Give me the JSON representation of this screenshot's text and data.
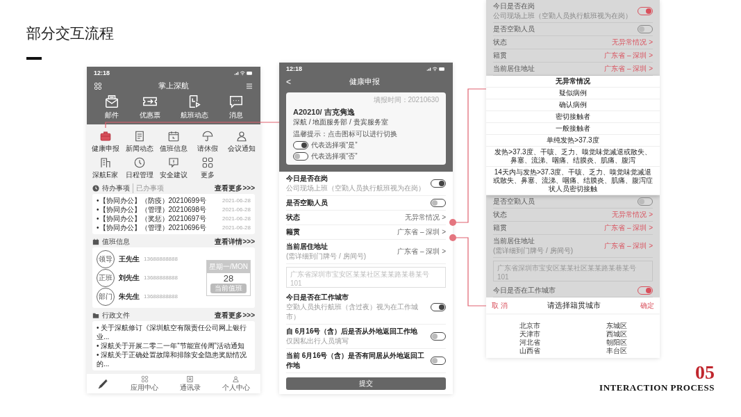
{
  "title": "部分交互流程",
  "home": {
    "time": "12:18",
    "title": "掌上深航",
    "shortcuts": [
      {
        "label": "邮件"
      },
      {
        "label": "优惠票"
      },
      {
        "label": "航班动态"
      },
      {
        "label": "消息"
      }
    ],
    "apps": [
      {
        "label": "健康申报",
        "selected": true
      },
      {
        "label": "新闻动态",
        "selected": false
      },
      {
        "label": "值班信息",
        "selected": false
      },
      {
        "label": "请休假",
        "selected": false
      },
      {
        "label": "会议通知",
        "selected": false
      },
      {
        "label": "深航E家",
        "selected": false
      },
      {
        "label": "日程管理",
        "selected": false
      },
      {
        "label": "安全建议",
        "selected": false
      },
      {
        "label": "更多",
        "selected": false
      }
    ],
    "todo": {
      "title": "待办事项",
      "tab": "已办事项",
      "more": "查看更多>>>",
      "items": [
        {
          "text": "•【协同办公】（防疫）20210699号",
          "date": "2021-06-28"
        },
        {
          "text": "•【协同办公】（管理）20210698号",
          "date": "2021-06-28"
        },
        {
          "text": "•【协同办公】（奖惩）20210697号",
          "date": "2021-06-28"
        },
        {
          "text": "•【协同办公】（管理）20210696号",
          "date": "2021-06-28"
        }
      ]
    },
    "duty": {
      "title": "值班信息",
      "more": "查看详情>>>",
      "people": [
        {
          "role": "领导",
          "name": "王先生",
          "phone": "13688888888"
        },
        {
          "role": "正班",
          "name": "刘先生",
          "phone": "13688888888"
        },
        {
          "role": "部门",
          "name": "朱先生",
          "phone": "13688888888"
        }
      ],
      "weekday": "星期一/MON",
      "day": "28",
      "badge": "当前值班"
    },
    "docs": {
      "title": "行政文件",
      "more": "查看更多>>>",
      "items": [
        {
          "text": "• 关于深航修订《深圳航空有限责任公司网上银行业..."
        },
        {
          "text": "• 深航关于开展二零二一年“节能宣传周”活动通知"
        },
        {
          "text": "• 深航关于正确处置故障和排除安全隐患奖励情况的..."
        }
      ]
    },
    "tabbar": [
      {
        "selected": true
      },
      {
        "label": "应用中心",
        "selected": false
      },
      {
        "label": "通讯录",
        "selected": false
      },
      {
        "label": "个人中心",
        "selected": false
      }
    ]
  },
  "form": {
    "time": "12:18",
    "back": "<",
    "title": "健康申报",
    "card": {
      "filled": "填报时间：20210630",
      "name": "A20210/ 吉克隽逸",
      "dept": "深航 / 地面服务部 / 贵宾服务室",
      "tip": "温馨提示：点击图标可以进行切换",
      "legend": [
        {
          "on": true,
          "text": "代表选择项“是”"
        },
        {
          "on": false,
          "text": "代表选择项“否”"
        }
      ]
    },
    "rows": [
      {
        "kind": "toggle",
        "label": "今日是否在岗",
        "sub": "公司现场上班（空勤人员执行航班视为在岗）",
        "on": true
      },
      {
        "kind": "toggle",
        "label": "是否空勤人员",
        "on": false
      },
      {
        "kind": "select",
        "label": "状态",
        "value": "无异常情况 >"
      },
      {
        "kind": "select",
        "label": "籍贯",
        "value": "广东省 – 深圳 >"
      },
      {
        "kind": "select",
        "label": "当前居住地址",
        "sub": "(需详细到门牌号 / 房间号)",
        "value": "广东省 – 深圳 >"
      },
      {
        "kind": "textarea",
        "placeholder": "广东省深圳市宝安区某某社区某某路某巷某号 101"
      },
      {
        "kind": "toggle",
        "label": "今日是否在工作城市",
        "sub": "空勤人员执行航班（含过夜）视为在工作城市）",
        "on": true
      },
      {
        "kind": "toggle",
        "label": "自 6月16号（含）后是否从外地返回工作地",
        "sub": "仅因私出行人员填写",
        "on": false
      },
      {
        "kind": "toggle",
        "label": "当前 6月16号（含）是否有同居从外地返回工作地",
        "on": false
      }
    ],
    "submit": "提交"
  },
  "status_picker": {
    "rows": [
      {
        "kind": "toggle",
        "label": "今日是否在岗",
        "sub": "公司现场上班（空勤人员执行航班视为在岗）",
        "on": true
      },
      {
        "kind": "toggle",
        "label": "是否空勤人员",
        "on": false
      },
      {
        "kind": "select",
        "label": "状态",
        "value": "无异常情况 >"
      },
      {
        "kind": "select",
        "label": "籍贯",
        "value": "广东省 – 深圳 >"
      },
      {
        "kind": "select",
        "label": "当前居住地址",
        "value": "广东省 – 深圳 >"
      }
    ],
    "options": [
      {
        "label": "无异常情况",
        "selected": true
      },
      {
        "label": "疑似病例",
        "selected": false
      },
      {
        "label": "确认病例",
        "selected": false
      },
      {
        "label": "密切接触者",
        "selected": false
      },
      {
        "label": "一般接触者",
        "selected": false
      },
      {
        "label": "单纯发热>37.3度",
        "selected": false
      },
      {
        "label": "发热>37.3度、干咳、乏力、嗅觉味觉减退或散失、鼻塞、流涕、咽痛、结膜炎、肌痛、腹泻",
        "selected": false
      },
      {
        "label": "14天内与发热>37.3度、干咳、乏力、嗅觉味觉减退或散失、鼻塞、流涕、咽痛、结膜炎、肌痛、腹泻症状人员密切接触",
        "selected": false
      }
    ]
  },
  "city_picker": {
    "rows": [
      {
        "kind": "toggle",
        "label": "是否空勤人员",
        "on": false
      },
      {
        "kind": "select",
        "label": "状态",
        "value": "无异常情况 >"
      },
      {
        "kind": "select",
        "label": "籍贯",
        "value": "广东省 – 深圳 >"
      },
      {
        "kind": "select",
        "label": "当前居住地址",
        "sub": "(需详细到门牌号 / 房间号)",
        "value": "广东省 – 深圳 >"
      },
      {
        "kind": "textarea",
        "placeholder": "广东省深圳市宝安区某某社区某某路某巷某号 101"
      },
      {
        "kind": "toggle",
        "label": "今日是否在工作城市",
        "on": true
      }
    ],
    "cancel": "取 消",
    "title": "请选择籍贯城市",
    "confirm": "确定",
    "provinces": [
      "北京市",
      "天津市",
      "河北省",
      "山西省"
    ],
    "districts": [
      "东城区",
      "西城区",
      "朝阳区",
      "丰台区"
    ]
  },
  "footer": {
    "number": "05",
    "caption": "INTERACTION PROCESS"
  }
}
